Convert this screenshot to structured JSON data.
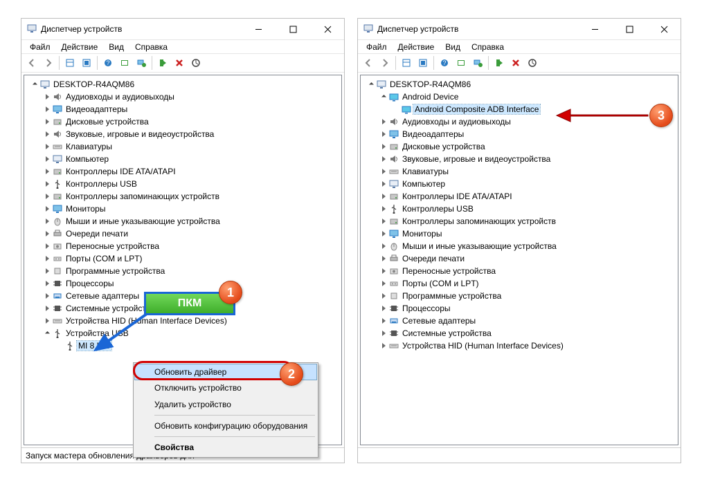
{
  "left": {
    "title": "Диспетчер устройств",
    "menubar": [
      "Файл",
      "Действие",
      "Вид",
      "Справка"
    ],
    "root": "DESKTOP-R4AQM86",
    "categories": [
      "Аудиовходы и аудиовыходы",
      "Видеоадаптеры",
      "Дисковые устройства",
      "Звуковые, игровые и видеоустройства",
      "Клавиатуры",
      "Компьютер",
      "Контроллеры IDE ATA/ATAPI",
      "Контроллеры USB",
      "Контроллеры запоминающих устройств",
      "Мониторы",
      "Мыши и иные указывающие устройства",
      "Очереди печати",
      "Переносные устройства",
      "Порты (COM и LPT)",
      "Программные устройства",
      "Процессоры",
      "Сетевые адаптеры",
      "Системные устройства",
      "Устройства HID (Human Interface Devices)"
    ],
    "usb_cat": "Устройства USB",
    "usb_device": "MI 8 Lite",
    "context_menu": [
      "Обновить драйвер",
      "Отключить устройство",
      "Удалить устройство",
      "Обновить конфигурацию оборудования",
      "Свойства"
    ],
    "statusbar": "Запуск мастера обновления драйверов для"
  },
  "right": {
    "title": "Диспетчер устройств",
    "menubar": [
      "Файл",
      "Действие",
      "Вид",
      "Справка"
    ],
    "root": "DESKTOP-R4AQM86",
    "android_cat": "Android Device",
    "android_device": "Android Composite ADB Interface",
    "categories": [
      "Аудиовходы и аудиовыходы",
      "Видеоадаптеры",
      "Дисковые устройства",
      "Звуковые, игровые и видеоустройства",
      "Клавиатуры",
      "Компьютер",
      "Контроллеры IDE ATA/ATAPI",
      "Контроллеры USB",
      "Контроллеры запоминающих устройств",
      "Мониторы",
      "Мыши и иные указывающие устройства",
      "Очереди печати",
      "Переносные устройства",
      "Порты (COM и LPT)",
      "Программные устройства",
      "Процессоры",
      "Сетевые адаптеры",
      "Системные устройства",
      "Устройства HID (Human Interface Devices)"
    ]
  },
  "callout": {
    "pkm": "ПКМ"
  }
}
